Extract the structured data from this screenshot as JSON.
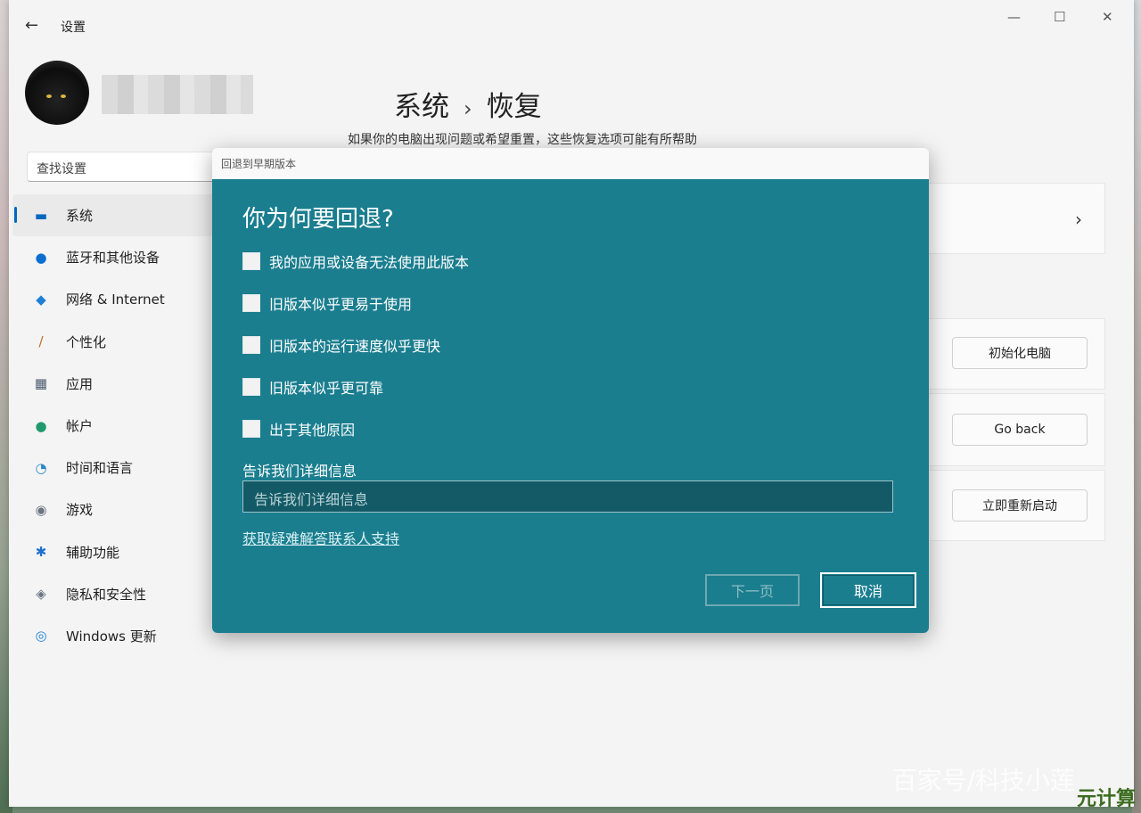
{
  "window": {
    "title": "设置",
    "back_icon": "←",
    "minimize_icon": "—",
    "maximize_icon": "☐",
    "close_icon": "✕"
  },
  "search": {
    "placeholder": "查找设置"
  },
  "sidebar": {
    "items": [
      {
        "label": "系统",
        "icon": "monitor-icon",
        "glyph": "▬",
        "color": "#0067c0",
        "active": true
      },
      {
        "label": "蓝牙和其他设备",
        "icon": "bluetooth-icon",
        "glyph": "●",
        "color": "#0a6fd1"
      },
      {
        "label": "网络 & Internet",
        "icon": "wifi-icon",
        "glyph": "◆",
        "color": "#1e80d8"
      },
      {
        "label": "个性化",
        "icon": "brush-icon",
        "glyph": "/",
        "color": "#c46a2b"
      },
      {
        "label": "应用",
        "icon": "apps-icon",
        "glyph": "▦",
        "color": "#4a5a6c"
      },
      {
        "label": "帐户",
        "icon": "person-icon",
        "glyph": "●",
        "color": "#1f9a6f"
      },
      {
        "label": "时间和语言",
        "icon": "clock-globe-icon",
        "glyph": "◔",
        "color": "#2a88c8"
      },
      {
        "label": "游戏",
        "icon": "gamepad-icon",
        "glyph": "◉",
        "color": "#6b7682"
      },
      {
        "label": "辅助功能",
        "icon": "accessibility-icon",
        "glyph": "✱",
        "color": "#1e6fd0"
      },
      {
        "label": "隐私和安全性",
        "icon": "shield-icon",
        "glyph": "◈",
        "color": "#6b7682"
      },
      {
        "label": "Windows 更新",
        "icon": "update-icon",
        "glyph": "◎",
        "color": "#1e80d8"
      }
    ]
  },
  "header": {
    "breadcrumb_parent": "系统",
    "breadcrumb_sep": "›",
    "breadcrumb_current": "恢复",
    "subtitle": "如果你的电脑出现问题或希望重置，这些恢复选项可能有所帮助"
  },
  "recovery": {
    "reset_button": "初始化电脑",
    "goback_button": "Go back",
    "restart_button": "立即重新启动",
    "chevron": "›"
  },
  "dialog": {
    "title": "回退到早期版本",
    "heading": "你为何要回退?",
    "options": [
      "我的应用或设备无法使用此版本",
      "旧版本似乎更易于使用",
      "旧版本的运行速度似乎更快",
      "旧版本似乎更可靠",
      "出于其他原因"
    ],
    "detail_label": "告诉我们详细信息",
    "detail_placeholder": "告诉我们详细信息",
    "help_link": "获取疑难解答联系人支持",
    "next_button": "下一页",
    "cancel_button": "取消"
  },
  "watermark": {
    "text": "百家号/科技小莲",
    "brand": "元计算"
  }
}
